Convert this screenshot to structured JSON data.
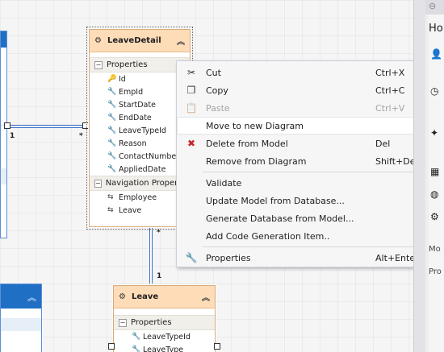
{
  "entities": {
    "leave_detail": {
      "title": "LeaveDetail",
      "properties_label": "Properties",
      "properties": [
        "Id",
        "EmpId",
        "StartDate",
        "EndDate",
        "LeaveTypeId",
        "Reason",
        "ContactNumber",
        "AppliedDate"
      ],
      "nav_label": "Navigation Properties",
      "nav_properties": [
        "Employee",
        "Leave"
      ]
    },
    "leave": {
      "title": "Leave",
      "properties_label": "Properties",
      "properties": [
        "LeaveTypeId",
        "LeaveType"
      ]
    }
  },
  "multiplicity": {
    "left_one": "1",
    "left_many": "*",
    "bottom_many": "*",
    "bottom_one": "1"
  },
  "context_menu": {
    "items": [
      {
        "label": "Cut",
        "shortcut": "Ctrl+X",
        "icon": "scissors-icon"
      },
      {
        "label": "Copy",
        "shortcut": "Ctrl+C",
        "icon": "copy-icon"
      },
      {
        "label": "Paste",
        "shortcut": "Ctrl+V",
        "icon": "paste-icon",
        "disabled": true
      },
      {
        "label": "Move to new Diagram",
        "shortcut": "",
        "hover": true
      },
      {
        "label": "Delete from Model",
        "shortcut": "Del",
        "icon": "delete-x-icon"
      },
      {
        "label": "Remove from Diagram",
        "shortcut": "Shift+Del"
      },
      {
        "label": "Validate",
        "shortcut": ""
      },
      {
        "label": "Update Model from Database...",
        "shortcut": ""
      },
      {
        "label": "Generate Database from Model...",
        "shortcut": ""
      },
      {
        "label": "Add Code Generation Item..",
        "shortcut": ""
      },
      {
        "label": "Properties",
        "shortcut": "Alt+Enter",
        "icon": "wrench-icon"
      }
    ]
  },
  "right_panel": {
    "title": "Ho",
    "label_mo": "Mo",
    "label_pro": "Pro"
  },
  "colors": {
    "entity_header": "#fedcb8",
    "connector": "#3c6fc7",
    "delete_icon": "#c8262c"
  }
}
